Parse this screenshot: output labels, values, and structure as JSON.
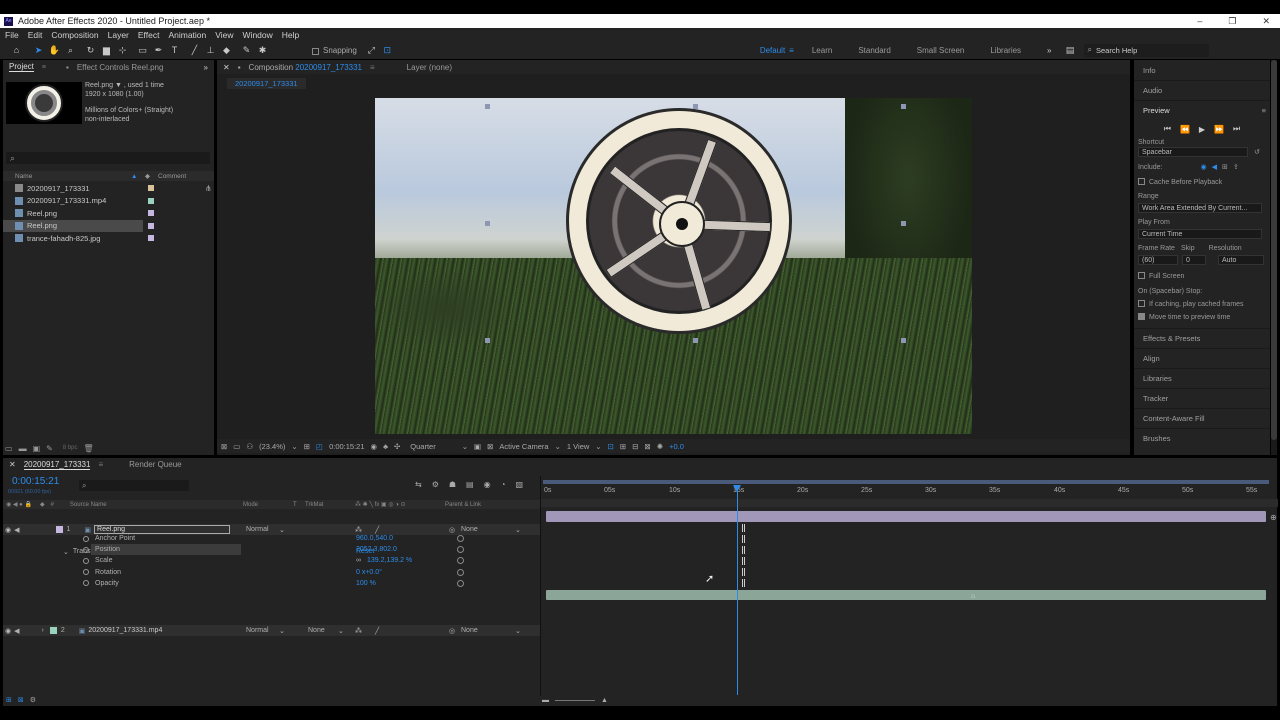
{
  "window": {
    "title": "Adobe After Effects 2020 - Untitled Project.aep *",
    "logo": "Ae",
    "controls": [
      "–",
      "❐",
      "✕"
    ]
  },
  "menu": [
    "File",
    "Edit",
    "Composition",
    "Layer",
    "Effect",
    "Animation",
    "View",
    "Window",
    "Help"
  ],
  "toolbar": {
    "tools": [
      "home-icon",
      "selection-tool-icon",
      "hand-tool-icon",
      "zoom-tool-icon",
      "rotate-tool-icon",
      "camera-tool-icon",
      "pan-behind-icon",
      "rectangle-tool-icon",
      "pen-tool-icon",
      "type-tool-icon",
      "brush-tool-icon",
      "clone-stamp-icon",
      "eraser-tool-icon",
      "roto-brush-icon",
      "puppet-tool-icon"
    ],
    "snapping_label": "Snapping",
    "workspaces": [
      "Default",
      "Learn",
      "Standard",
      "Small Screen",
      "Libraries"
    ],
    "search_placeholder": "Search Help"
  },
  "project_panel": {
    "tabs": [
      "Project",
      "Effect Controls Reel.png"
    ],
    "preview_name": "Reel.png ▼ , used 1 time",
    "preview_dims": "1920 x 1080 (1.00)",
    "preview_colors": "Millions of Colors+ (Straight)",
    "preview_interlace": "non-interlaced",
    "search_placeholder": "",
    "columns": {
      "name": "Name",
      "comment": "Comment"
    },
    "items": [
      {
        "name": "20200917_173331",
        "color": "#d9c29a",
        "type": "comp"
      },
      {
        "name": "20200917_173331.mp4",
        "color": "#9ad3bd",
        "type": "footage"
      },
      {
        "name": "Reel.png",
        "color": "#c6b7e0",
        "type": "image"
      },
      {
        "name": "Reel.png",
        "color": "#c6b7e0",
        "type": "image",
        "selected": true
      },
      {
        "name": "trance-fahadh-825.jpg",
        "color": "#c6b7e0",
        "type": "image"
      }
    ],
    "bpc": "8 bpc"
  },
  "comp_panel": {
    "tab_label": "Composition",
    "tab_name": "20200917_173331",
    "layer_tab": "Layer (none)",
    "breadcrumb": "20200917_173331",
    "zoom": "(23.4%)",
    "timecode": "0:00:15:21",
    "resolution": "Quarter",
    "camera": "Active Camera",
    "views": "1 View",
    "exposure": "+0.0"
  },
  "right_panel": {
    "info": "Info",
    "audio": "Audio",
    "preview_title": "Preview",
    "shortcut_label": "Shortcut",
    "shortcut_value": "Spacebar",
    "include_label": "Include:",
    "cache_before": "Cache Before Playback",
    "range_label": "Range",
    "range_value": "Work Area Extended By Current...",
    "play_from_label": "Play From",
    "play_from_value": "Current Time",
    "frame_rate_label": "Frame Rate",
    "skip_label": "Skip",
    "resolution_label": "Resolution",
    "frame_rate_value": "(60)",
    "skip_value": "0",
    "resolution_value": "Auto",
    "full_screen": "Full Screen",
    "on_stop": "On (Spacebar) Stop:",
    "if_caching": "If caching, play cached frames",
    "move_time": "Move time to preview time",
    "panels": [
      "Effects & Presets",
      "Align",
      "Libraries",
      "Tracker",
      "Content-Aware Fill",
      "Brushes"
    ]
  },
  "timeline": {
    "tab_name": "20200917_173331",
    "render_queue": "Render Queue",
    "timecode": "0:00:15:21",
    "frame_info": "00921 (60.00 fps)",
    "headers": {
      "source": "Source Name",
      "mode": "Mode",
      "t": "T",
      "trkmat": "TrkMat",
      "parent": "Parent & Link"
    },
    "layers": [
      {
        "num": "1",
        "name": "Reel.png",
        "mode": "Normal",
        "parent": "None",
        "color": "#c6b7e0"
      },
      {
        "num": "2",
        "name": "20200917_173331.mp4",
        "mode": "Normal",
        "trkmat": "None",
        "parent": "None",
        "color": "#9ad3bd"
      }
    ],
    "transform": {
      "label": "Transform",
      "reset": "Reset",
      "props": [
        {
          "name": "Anchor Point",
          "value": "960.0,540.0"
        },
        {
          "name": "Position",
          "value": "2052.3,802.0"
        },
        {
          "name": "Scale",
          "value": "139.2,139.2 %"
        },
        {
          "name": "Rotation",
          "value": "0 x+0.0°"
        },
        {
          "name": "Opacity",
          "value": "100 %"
        }
      ]
    },
    "ruler": [
      "0s",
      "05s",
      "10s",
      "15s",
      "20s",
      "25s",
      "30s",
      "35s",
      "40s",
      "45s",
      "50s",
      "55s"
    ],
    "playhead_seconds": 15.35
  }
}
